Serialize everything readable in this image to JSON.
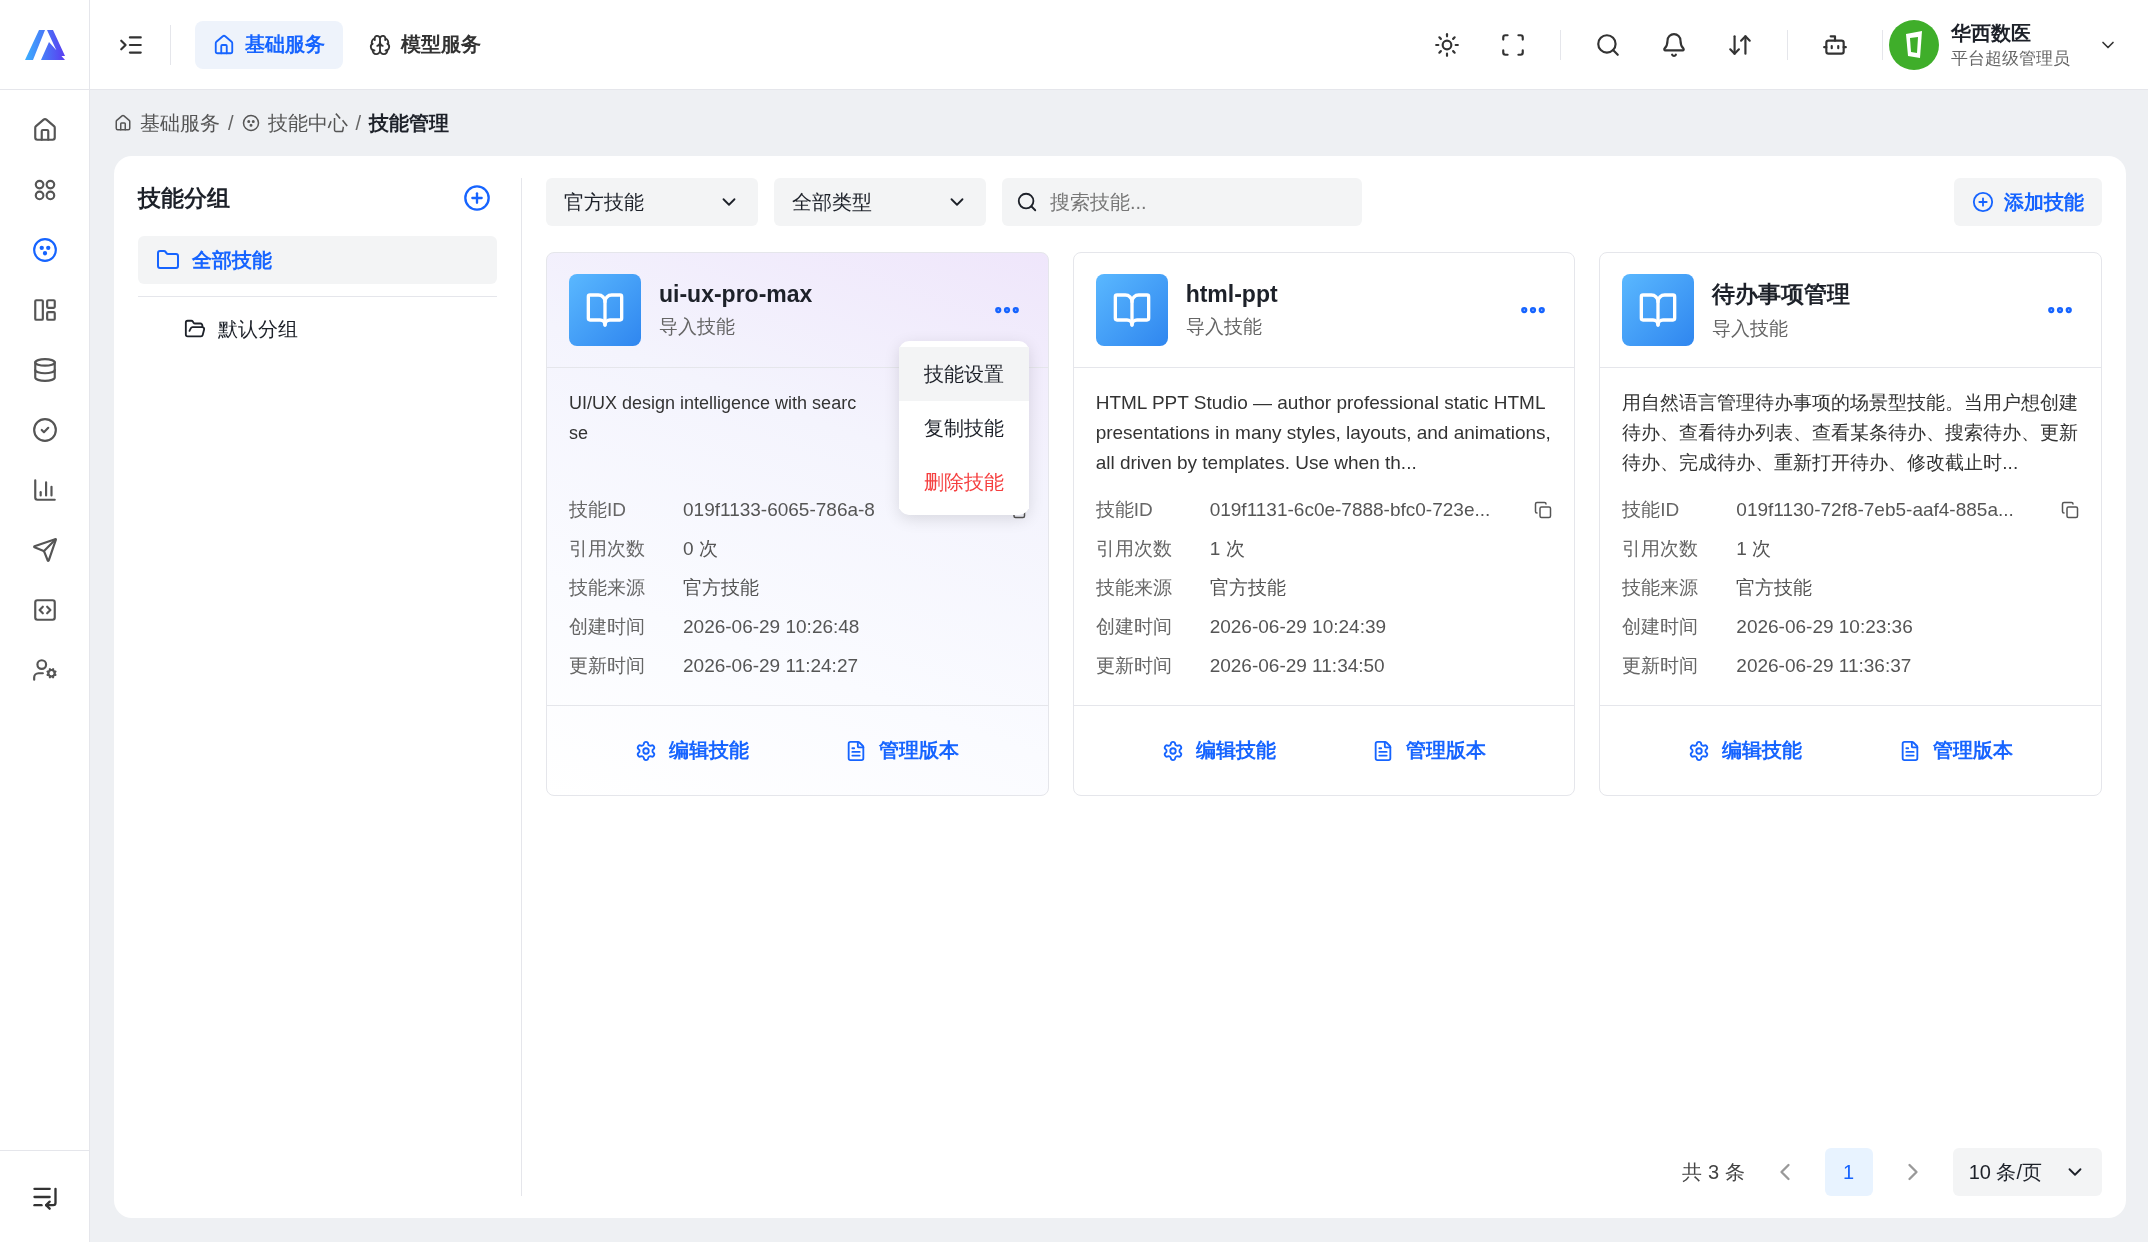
{
  "top_tabs": [
    {
      "label": "基础服务",
      "selected": true,
      "kind": "home"
    },
    {
      "label": "模型服务",
      "selected": false,
      "kind": "brain"
    }
  ],
  "user": {
    "name": "华西数医",
    "role": "平台超级管理员"
  },
  "sidebar": {
    "items": [
      {
        "kind": "home",
        "selected": false
      },
      {
        "kind": "apps",
        "selected": false
      },
      {
        "kind": "skills",
        "selected": true
      },
      {
        "kind": "layout",
        "selected": false
      },
      {
        "kind": "database",
        "selected": false
      },
      {
        "kind": "check",
        "selected": false
      },
      {
        "kind": "chart",
        "selected": false
      },
      {
        "kind": "send",
        "selected": false
      },
      {
        "kind": "code",
        "selected": false
      },
      {
        "kind": "user",
        "selected": false
      }
    ]
  },
  "breadcrumb": [
    {
      "label": "基础服务",
      "kind": "home",
      "selected": false
    },
    {
      "separator": "/",
      "label": "技能中心",
      "kind": "skills",
      "selected": false
    },
    {
      "separator": "/",
      "label": "技能管理",
      "kind": "none",
      "selected": true
    }
  ],
  "groups": {
    "title": "技能分组",
    "items": [
      {
        "label": "全部技能",
        "selected": true,
        "children": [
          {
            "label": "默认分组",
            "selected": false
          }
        ]
      }
    ]
  },
  "filters": [
    {
      "value": "官方技能"
    },
    {
      "value": "全部类型"
    }
  ],
  "search": {
    "placeholder": "搜索技能..."
  },
  "add_button": "添加技能",
  "cards": [
    {
      "name": "ui-ux-pro-max",
      "subtitle": "导入技能",
      "highlighted": true,
      "description": "UI/UX design intelligence with searc\nse",
      "fields": [
        {
          "label": "技能ID",
          "value": "019f1133-6065-786a-8",
          "copyable": true
        },
        {
          "label": "引用次数",
          "value": "0 次",
          "copyable": false
        },
        {
          "label": "技能来源",
          "value": "官方技能",
          "copyable": false
        },
        {
          "label": "创建时间",
          "value": "2026-06-29 10:26:48",
          "copyable": false
        },
        {
          "label": "更新时间",
          "value": "2026-06-29 11:24:27",
          "copyable": false
        }
      ],
      "actions": [
        {
          "label": "编辑技能",
          "kind": "edit"
        },
        {
          "label": "管理版本",
          "kind": "versions"
        }
      ],
      "menu": [
        {
          "label": "技能设置",
          "kind": "normal",
          "highlighted": true
        },
        {
          "label": "复制技能",
          "kind": "normal",
          "highlighted": false
        },
        {
          "label": "删除技能",
          "kind": "danger",
          "highlighted": false
        }
      ]
    },
    {
      "name": "html-ppt",
      "subtitle": "导入技能",
      "highlighted": false,
      "description": "HTML PPT Studio — author professional static HTML presentations in many styles, layouts, and animations, all driven by templates. Use when th...",
      "fields": [
        {
          "label": "技能ID",
          "value": "019f1131-6c0e-7888-bfc0-723e...",
          "copyable": true
        },
        {
          "label": "引用次数",
          "value": "1 次",
          "copyable": false
        },
        {
          "label": "技能来源",
          "value": "官方技能",
          "copyable": false
        },
        {
          "label": "创建时间",
          "value": "2026-06-29 10:24:39",
          "copyable": false
        },
        {
          "label": "更新时间",
          "value": "2026-06-29 11:34:50",
          "copyable": false
        }
      ],
      "actions": [
        {
          "label": "编辑技能",
          "kind": "edit"
        },
        {
          "label": "管理版本",
          "kind": "versions"
        }
      ]
    },
    {
      "name": "待办事项管理",
      "subtitle": "导入技能",
      "highlighted": false,
      "description": "用自然语言管理待办事项的场景型技能。当用户想创建待办、查看待办列表、查看某条待办、搜索待办、更新待办、完成待办、重新打开待办、修改截止时...",
      "fields": [
        {
          "label": "技能ID",
          "value": "019f1130-72f8-7eb5-aaf4-885a...",
          "copyable": true
        },
        {
          "label": "引用次数",
          "value": "1 次",
          "copyable": false
        },
        {
          "label": "技能来源",
          "value": "官方技能",
          "copyable": false
        },
        {
          "label": "创建时间",
          "value": "2026-06-29 10:23:36",
          "copyable": false
        },
        {
          "label": "更新时间",
          "value": "2026-06-29 11:36:37",
          "copyable": false
        }
      ],
      "actions": [
        {
          "label": "编辑技能",
          "kind": "edit"
        },
        {
          "label": "管理版本",
          "kind": "versions"
        }
      ]
    }
  ],
  "pagination": {
    "total": "共 3 条",
    "pages": [
      {
        "label": "1",
        "selected": true
      }
    ],
    "page_size": "10 条/页"
  }
}
